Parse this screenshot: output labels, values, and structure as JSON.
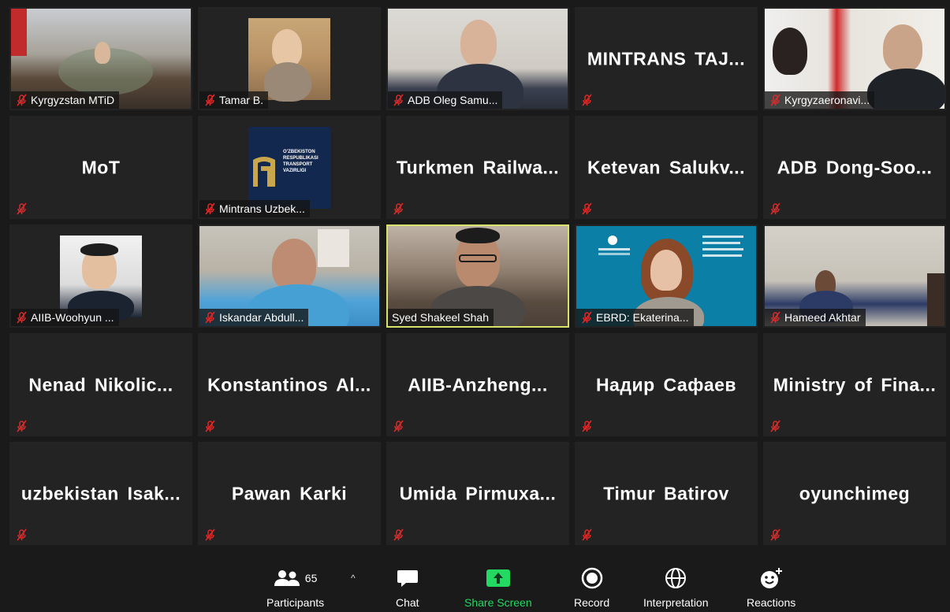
{
  "tiles": [
    {
      "name": "Kyrgyzstan MTiD",
      "type": "video",
      "muted": true
    },
    {
      "name": "Tamar B.",
      "type": "video",
      "muted": true
    },
    {
      "name": "ADB Oleg Samu...",
      "type": "video",
      "muted": true
    },
    {
      "name": "MINTRANS TAJ...",
      "type": "name",
      "muted": true
    },
    {
      "name": "Kyrgyzaeronavi...",
      "type": "video",
      "muted": true
    },
    {
      "name": "MoT",
      "type": "name",
      "muted": true
    },
    {
      "name": "Mintrans Uzbek...",
      "type": "video",
      "muted": true
    },
    {
      "name": "Turkmen Railwa...",
      "type": "name",
      "muted": true
    },
    {
      "name": "Ketevan Salukv...",
      "type": "name",
      "muted": true
    },
    {
      "name": "ADB Dong-Soo...",
      "type": "name",
      "muted": true
    },
    {
      "name": "AIIB-Woohyun ...",
      "type": "video",
      "muted": true
    },
    {
      "name": "Iskandar Abdull...",
      "type": "video",
      "muted": true
    },
    {
      "name": "Syed Shakeel Shah",
      "type": "video",
      "muted": false,
      "speaking": true
    },
    {
      "name": "EBRD: Ekaterina...",
      "type": "video",
      "muted": true
    },
    {
      "name": "Hameed Akhtar",
      "type": "video",
      "muted": true
    },
    {
      "name": "Nenad Nikolic...",
      "type": "name",
      "muted": true
    },
    {
      "name": "Konstantinos Al...",
      "type": "name",
      "muted": true
    },
    {
      "name": "AIIB-Anzheng...",
      "type": "name",
      "muted": true
    },
    {
      "name": "Надир Сафаев",
      "type": "name",
      "muted": true
    },
    {
      "name": "Ministry of Fina...",
      "type": "name",
      "muted": true
    },
    {
      "name": "uzbekistan Isak...",
      "type": "name",
      "muted": true
    },
    {
      "name": "Pawan Karki",
      "type": "name",
      "muted": true
    },
    {
      "name": "Umida Pirmuxa...",
      "type": "name",
      "muted": true
    },
    {
      "name": "Timur Batirov",
      "type": "name",
      "muted": true
    },
    {
      "name": "oyunchimeg",
      "type": "name",
      "muted": true
    }
  ],
  "uzb_logo_text": "O'ZBEKISTON RESPUBLIKASI TRANSPORT VAZIRLIGI",
  "toolbar": {
    "participants_label": "Participants",
    "participants_count": "65",
    "chat_label": "Chat",
    "share_label": "Share Screen",
    "record_label": "Record",
    "interpretation_label": "Interpretation",
    "reactions_label": "Reactions"
  },
  "colors": {
    "background": "#1a1a1a",
    "tile": "#232323",
    "speaking_border": "#d6e26a",
    "share_green": "#23d962",
    "mute_red": "#e02828"
  }
}
